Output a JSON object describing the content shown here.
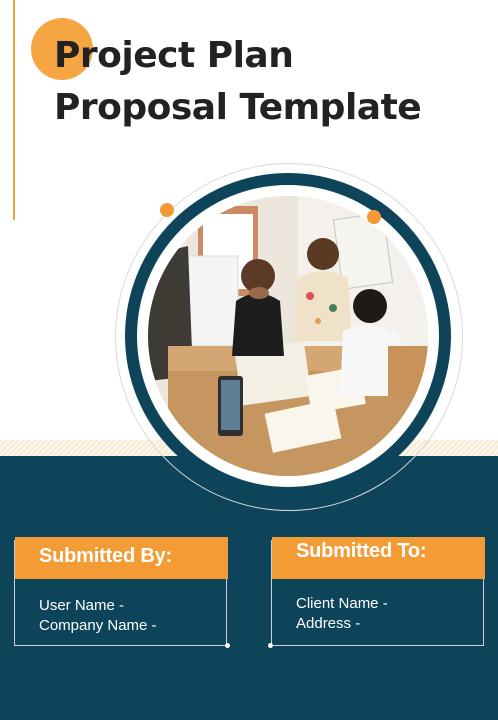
{
  "title": {
    "line1": "Project Plan",
    "line2": "Proposal Template"
  },
  "image": {
    "description_icon": "team-meeting-photo"
  },
  "submitted_by": {
    "heading": "Submitted By:",
    "line1": "User Name -",
    "line2": "Company Name -"
  },
  "submitted_to": {
    "heading": "Submitted To:",
    "line1": "Client Name -",
    "line2": "Address -"
  },
  "colors": {
    "accent": "#f39b35",
    "dark": "#0d4459",
    "title": "#222222"
  }
}
